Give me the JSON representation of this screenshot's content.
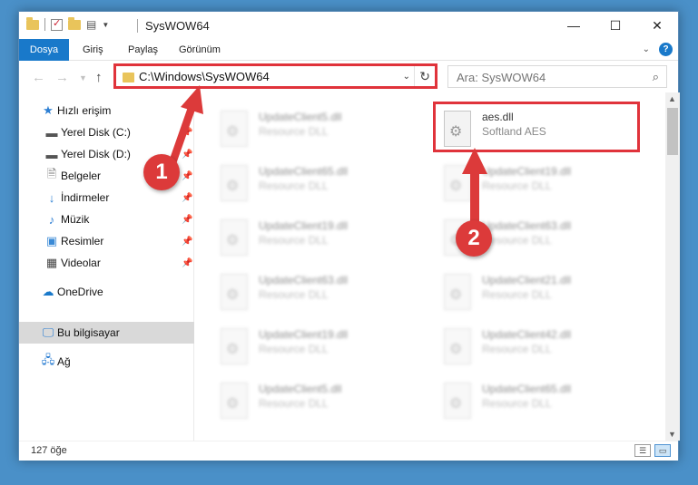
{
  "window": {
    "title": "SysWOW64",
    "controls": {
      "minimize": "—",
      "maximize": "☐",
      "close": "✕"
    }
  },
  "ribbon": {
    "tabs": [
      "Dosya",
      "Giriş",
      "Paylaş",
      "Görünüm"
    ]
  },
  "address": {
    "path": "C:\\Windows\\SysWOW64",
    "search_placeholder": "Ara: SysWOW64"
  },
  "navpane": {
    "quick_access": "Hızlı erişim",
    "items": [
      {
        "label": "Yerel Disk (C:)",
        "icon": "drive-icon",
        "pinned": true
      },
      {
        "label": "Yerel Disk (D:)",
        "icon": "drive-icon",
        "pinned": true
      },
      {
        "label": "Belgeler",
        "icon": "documents-icon",
        "pinned": true
      },
      {
        "label": "İndirmeler",
        "icon": "downloads-icon",
        "pinned": true
      },
      {
        "label": "Müzik",
        "icon": "music-icon",
        "pinned": true
      },
      {
        "label": "Resimler",
        "icon": "pictures-icon",
        "pinned": true
      },
      {
        "label": "Videolar",
        "icon": "videos-icon",
        "pinned": true
      }
    ],
    "onedrive": "OneDrive",
    "this_pc": "Bu bilgisayar",
    "network": "Ağ"
  },
  "files": {
    "left_column": [
      {
        "name": "UpdateClient5.dll",
        "type": "Resource DLL"
      },
      {
        "name": "UpdateClient65.dll",
        "type": "Resource DLL"
      },
      {
        "name": "UpdateClient19.dll",
        "type": "Resource DLL"
      },
      {
        "name": "UpdateClient63.dll",
        "type": "Resource DLL"
      },
      {
        "name": "UpdateClient19.dll",
        "type": "Resource DLL"
      },
      {
        "name": "UpdateClient5.dll",
        "type": "Resource DLL"
      }
    ],
    "right_column": [
      {
        "name": "aes.dll",
        "type": "Softland AES"
      },
      {
        "name": "UpdateClient19.dll",
        "type": "Resource DLL"
      },
      {
        "name": "UpdateClient63.dll",
        "type": "Resource DLL"
      },
      {
        "name": "UpdateClient21.dll",
        "type": "Resource DLL"
      },
      {
        "name": "UpdateClient42.dll",
        "type": "Resource DLL"
      },
      {
        "name": "UpdateClient65.dll",
        "type": "Resource DLL"
      }
    ]
  },
  "status": {
    "item_count": "127 öğe"
  },
  "annotations": {
    "step1": "1",
    "step2": "2",
    "color": "#dc3a3a"
  }
}
